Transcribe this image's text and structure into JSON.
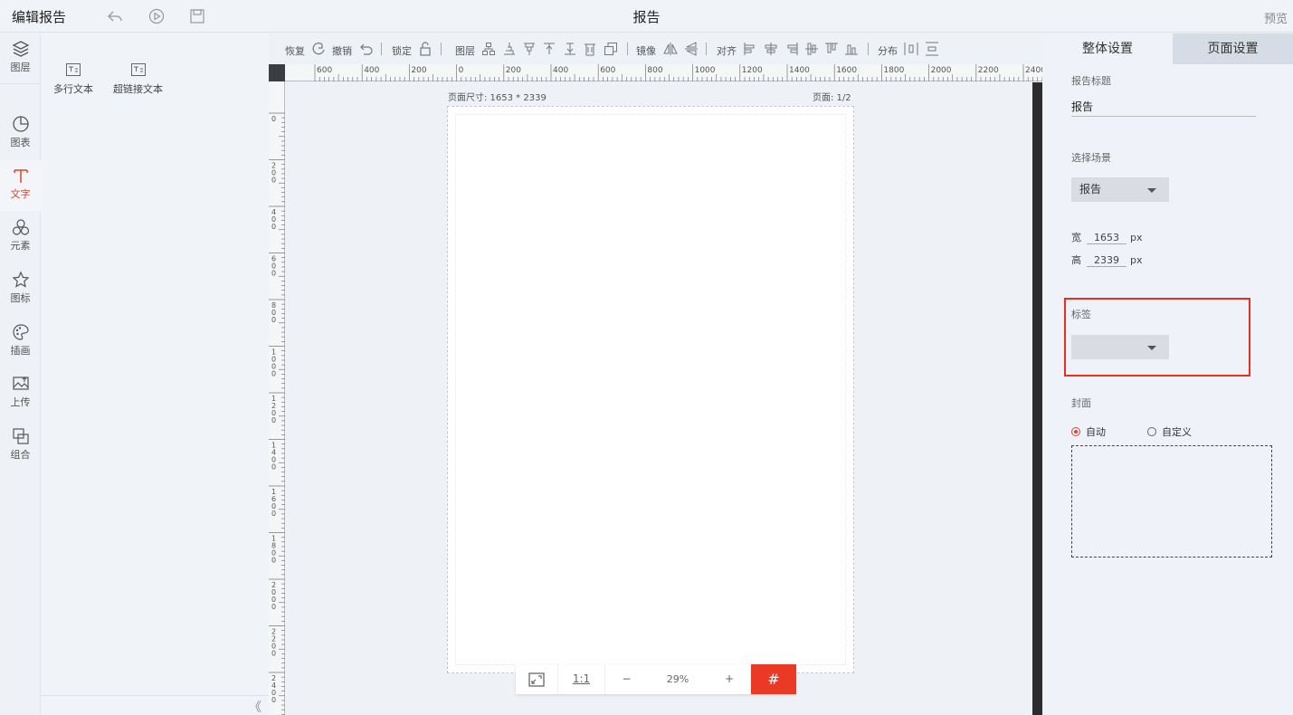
{
  "topbar": {
    "app_title": "编辑报告",
    "center_title": "报告",
    "preview_label": "预览"
  },
  "rail": {
    "items": [
      {
        "label": "图层",
        "icon": "layers-icon"
      },
      {
        "label": "图表",
        "icon": "pie-chart-icon"
      },
      {
        "label": "文字",
        "icon": "text-icon",
        "active": true
      },
      {
        "label": "元素",
        "icon": "shapes-icon"
      },
      {
        "label": "图标",
        "icon": "star-icon"
      },
      {
        "label": "插画",
        "icon": "palette-icon"
      },
      {
        "label": "上传",
        "icon": "upload-image-icon"
      },
      {
        "label": "组合",
        "icon": "group-icon"
      }
    ]
  },
  "element_panel": {
    "items": [
      {
        "label": "多行文本"
      },
      {
        "label": "超链接文本"
      }
    ]
  },
  "toolbar": {
    "redo_label": "恢复",
    "undo_label": "撤销",
    "lock_label": "锁定",
    "layer_label": "图层",
    "mirror_label": "镜像",
    "align_label": "对齐",
    "distribute_label": "分布"
  },
  "ruler": {
    "h_labels": [
      "600",
      "400",
      "200",
      "0",
      "200",
      "400",
      "600",
      "800",
      "1000",
      "1200",
      "1400",
      "1600",
      "1800",
      "2000",
      "2200",
      "2400"
    ],
    "v_labels": [
      "0",
      "200",
      "400",
      "600",
      "800",
      "1000",
      "1200",
      "1400",
      "1600",
      "1800",
      "2000",
      "2200",
      "2400"
    ]
  },
  "canvas": {
    "page_size": "页面尺寸: 1653 * 2339",
    "page_num": "页面: 1/2"
  },
  "zoom": {
    "fit_icon": "fit-screen-icon",
    "actual_size": "1:1",
    "minus": "−",
    "level": "29%",
    "plus": "+",
    "grid": "#"
  },
  "rpanel": {
    "tab_overall": "整体设置",
    "tab_page": "页面设置",
    "report_title_label": "报告标题",
    "report_title_value": "报告",
    "scene_label": "选择场景",
    "scene_value": "报告",
    "width_label": "宽",
    "width_value": "1653",
    "height_label": "高",
    "height_value": "2339",
    "unit": "px",
    "tag_label": "标签",
    "tag_value": "",
    "cover_label": "封面",
    "cover_auto": "自动",
    "cover_custom": "自定义"
  },
  "colors": {
    "accent": "#e8412c",
    "grid_button": "#ea3a26"
  }
}
